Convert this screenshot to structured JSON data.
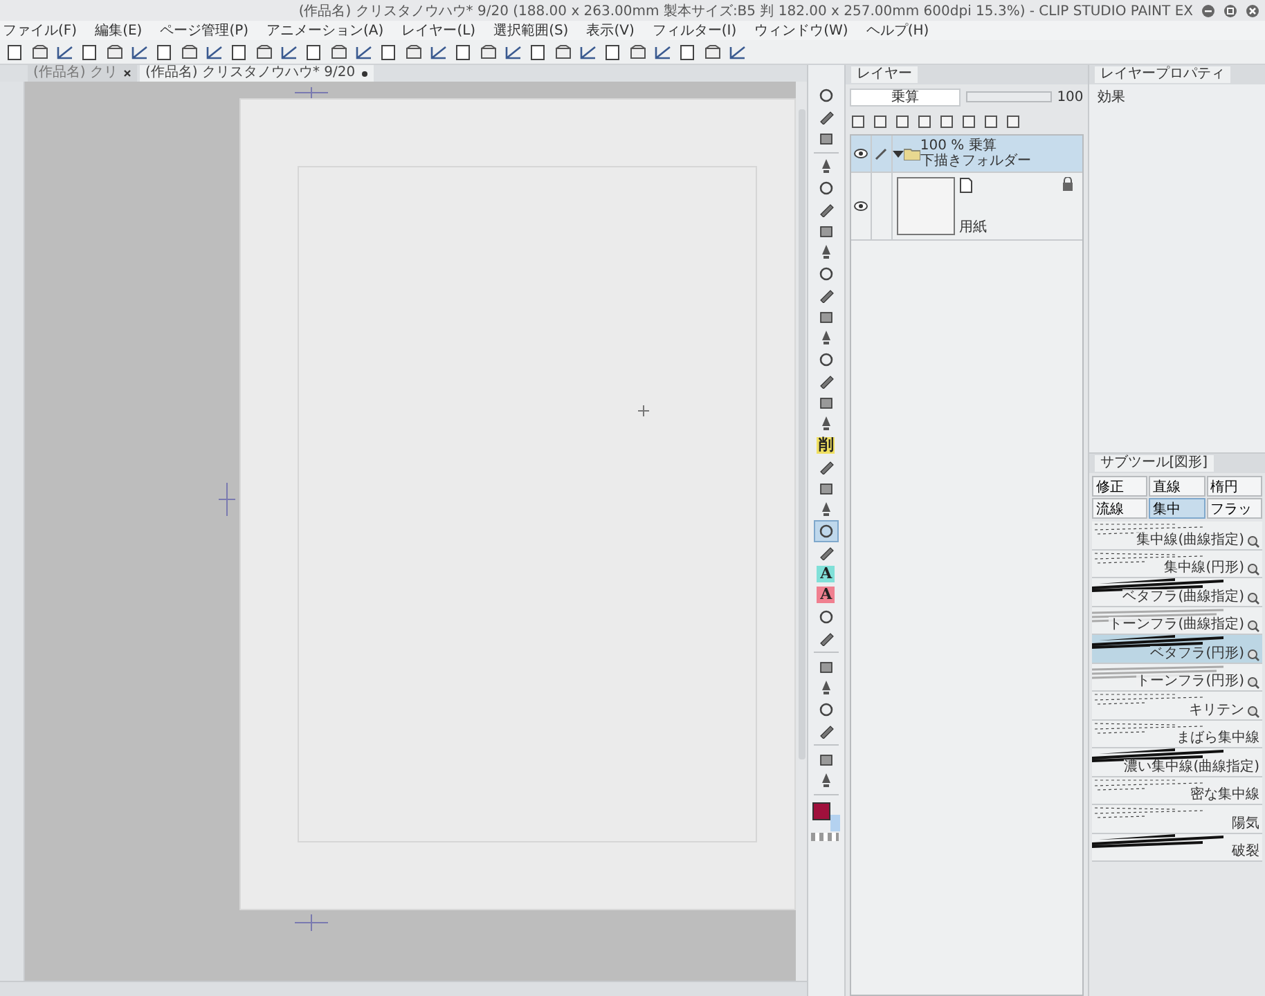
{
  "window": {
    "title": "(作品名) クリスタノウハウ* 9/20 (188.00 x 263.00mm 製本サイズ:B5 判 182.00 x 257.00mm 600dpi 15.3%) - CLIP STUDIO PAINT EX"
  },
  "menu": [
    "ファイル(F)",
    "編集(E)",
    "ページ管理(P)",
    "アニメーション(A)",
    "レイヤー(L)",
    "選択範囲(S)",
    "表示(V)",
    "フィルター(I)",
    "ウィンドウ(W)",
    "ヘルプ(H)"
  ],
  "document_tabs": [
    {
      "label": "(作品名) クリ",
      "selected": false,
      "kind": "close"
    },
    {
      "label": "(作品名) クリスタノウハウ* 9/20",
      "selected": true,
      "kind": "modified"
    }
  ],
  "tool_groups": [
    [
      {
        "kind": "icon",
        "selected": false
      },
      {
        "kind": "icon",
        "selected": false
      },
      {
        "kind": "icon",
        "selected": false
      }
    ],
    [
      {
        "kind": "icon",
        "selected": false
      },
      {
        "kind": "icon",
        "selected": false
      },
      {
        "kind": "icon",
        "selected": false
      },
      {
        "kind": "icon",
        "selected": false
      },
      {
        "kind": "icon",
        "selected": false
      },
      {
        "kind": "icon",
        "selected": false
      },
      {
        "kind": "icon",
        "selected": false
      },
      {
        "kind": "icon",
        "selected": false
      },
      {
        "kind": "icon",
        "selected": false
      },
      {
        "kind": "icon",
        "selected": false
      },
      {
        "kind": "icon",
        "selected": false
      },
      {
        "kind": "icon",
        "selected": false
      },
      {
        "kind": "icon",
        "selected": false
      },
      {
        "kind": "glyph",
        "glyph": "削",
        "color": "#f0e060",
        "selected": false
      },
      {
        "kind": "icon",
        "selected": false
      },
      {
        "kind": "icon",
        "selected": false
      },
      {
        "kind": "icon",
        "selected": false
      },
      {
        "kind": "icon",
        "selected": true
      },
      {
        "kind": "icon",
        "selected": false
      },
      {
        "kind": "glyph",
        "glyph": "A",
        "color": "#80e0d8",
        "selected": false
      },
      {
        "kind": "glyph",
        "glyph": "A",
        "color": "#f08090",
        "selected": false
      },
      {
        "kind": "icon",
        "selected": false
      },
      {
        "kind": "icon",
        "selected": false
      }
    ],
    [
      {
        "kind": "icon",
        "selected": false
      },
      {
        "kind": "icon",
        "selected": false
      },
      {
        "kind": "icon",
        "selected": false
      },
      {
        "kind": "icon",
        "selected": false
      }
    ],
    [
      {
        "kind": "icon",
        "selected": false
      },
      {
        "kind": "icon",
        "selected": false
      }
    ]
  ],
  "color_swatches": [
    {
      "kind": "main",
      "color": "#a0103c"
    },
    {
      "kind": "sub",
      "color": "#b4d2f0"
    }
  ],
  "layer_panel": {
    "tab": "レイヤー",
    "blend_mode": "乗算",
    "opacity": "100",
    "opacity_slider": {
      "level": 1
    },
    "layers": [
      {
        "kind": "folder",
        "opacity_blend": "100 % 乗算",
        "name": "下描きフォルダー",
        "visible": true,
        "expanded": true,
        "locked": false,
        "selected": true
      },
      {
        "kind": "paper",
        "name": "用紙",
        "visible": true,
        "locked": true,
        "selected": false
      }
    ]
  },
  "property_panel": {
    "tab": "レイヤープロパティ",
    "section": "効果"
  },
  "subtool_panel": {
    "tab": "サブツール[図形]",
    "groups": [
      {
        "label": "修正",
        "selected": false
      },
      {
        "label": "直線",
        "selected": false
      },
      {
        "label": "楕円",
        "selected": false
      },
      {
        "label": "流線",
        "selected": false
      },
      {
        "label": "集中",
        "selected": true
      },
      {
        "label": "フラッ",
        "selected": false
      }
    ],
    "items": [
      {
        "name": "集中線(曲線指定)",
        "kind": "lines",
        "magnifier": true,
        "selected": false
      },
      {
        "name": "集中線(円形)",
        "kind": "lines",
        "magnifier": true,
        "selected": false
      },
      {
        "name": "ベタフラ(曲線指定)",
        "kind": "solid",
        "magnifier": true,
        "selected": false
      },
      {
        "name": "トーンフラ(曲線指定)",
        "kind": "tone",
        "magnifier": true,
        "selected": false
      },
      {
        "name": "ベタフラ(円形)",
        "kind": "solid",
        "magnifier": true,
        "selected": true
      },
      {
        "name": "トーンフラ(円形)",
        "kind": "tone",
        "magnifier": true,
        "selected": false
      },
      {
        "name": "キリテン",
        "kind": "lines",
        "magnifier": true,
        "selected": false
      },
      {
        "name": "まばら集中線",
        "kind": "lines",
        "magnifier": false,
        "selected": false
      },
      {
        "name": "濃い集中線(曲線指定)",
        "kind": "solid",
        "magnifier": false,
        "selected": false
      },
      {
        "name": "密な集中線",
        "kind": "lines",
        "magnifier": false,
        "selected": false
      },
      {
        "name": "陽気",
        "kind": "lines",
        "magnifier": false,
        "selected": false
      },
      {
        "name": "破裂",
        "kind": "solid",
        "magnifier": false,
        "selected": false
      }
    ]
  }
}
